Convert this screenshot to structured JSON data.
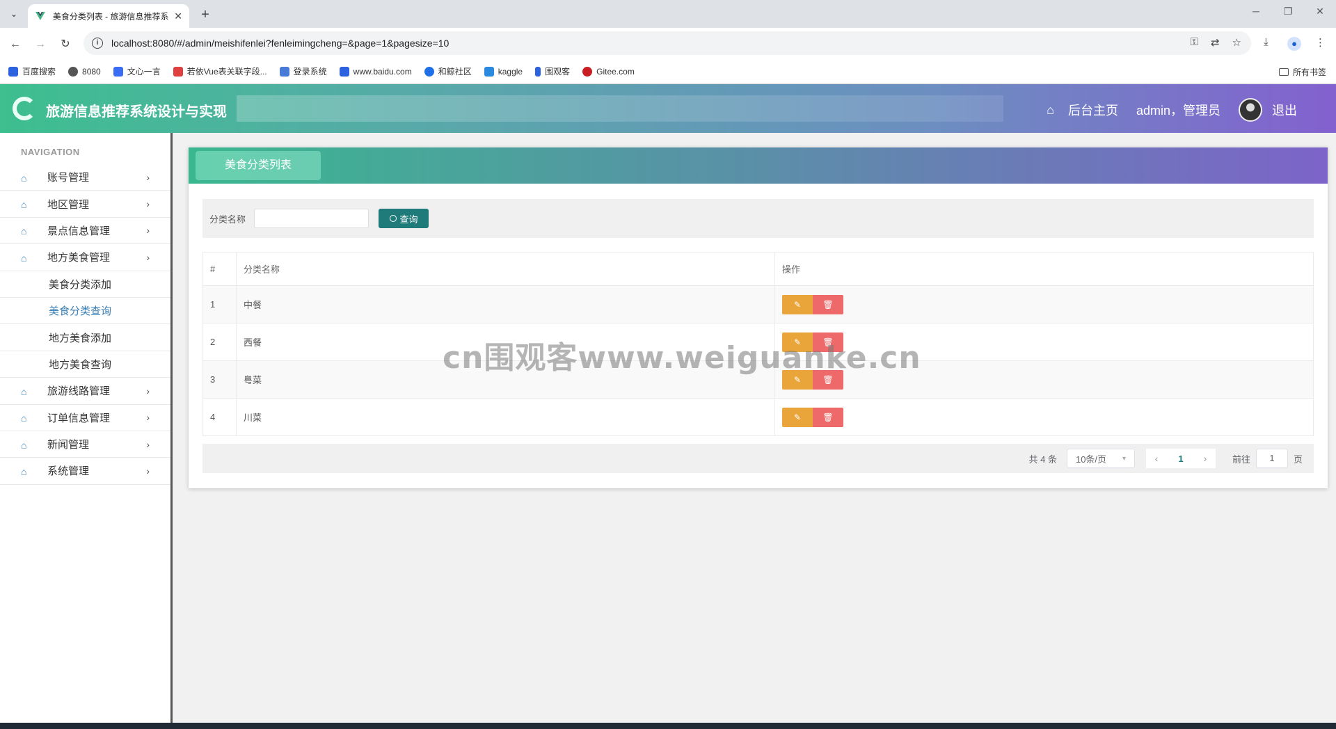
{
  "browser": {
    "tab_title": "美食分类列表 - 旅游信息推荐系统设计与实现",
    "tab_close": "✕",
    "new_tab": "+",
    "url": "localhost:8080/#/admin/meishifenlei?fenleimingcheng=&page=1&pagesize=10",
    "bookmarks": [
      {
        "label": "百度搜索",
        "color": "#2c62e0"
      },
      {
        "label": "8080",
        "color": "#555555"
      },
      {
        "label": "文心一言",
        "color": "#3a6cf4"
      },
      {
        "label": "若依Vue表关联字段...",
        "color": "#e04040"
      },
      {
        "label": "登录系统",
        "color": "#4a7ad8"
      },
      {
        "label": "www.baidu.com",
        "color": "#2c62e0"
      },
      {
        "label": "和鲸社区",
        "color": "#1e6fe8"
      },
      {
        "label": "kaggle",
        "color": "#2a8ae0"
      },
      {
        "label": "围观客",
        "color": "#2c62e0"
      },
      {
        "label": "Gitee.com",
        "color": "#c71d23"
      }
    ],
    "all_bookmarks": "所有书签"
  },
  "header": {
    "title": "旅游信息推荐系统设计与实现",
    "home_link": "后台主页",
    "user": "admin，管理员",
    "logout": "退出"
  },
  "sidebar": {
    "heading": "NAVIGATION",
    "items": [
      {
        "label": "账号管理"
      },
      {
        "label": "地区管理"
      },
      {
        "label": "景点信息管理"
      },
      {
        "label": "地方美食管理"
      }
    ],
    "sub_items": [
      {
        "label": "美食分类添加"
      },
      {
        "label": "美食分类查询"
      },
      {
        "label": "地方美食添加"
      },
      {
        "label": "地方美食查询"
      }
    ],
    "items_after": [
      {
        "label": "旅游线路管理"
      },
      {
        "label": "订单信息管理"
      },
      {
        "label": "新闻管理"
      },
      {
        "label": "系统管理"
      }
    ]
  },
  "main": {
    "card_title": "美食分类列表",
    "search_label": "分类名称",
    "search_value": "",
    "query_button": "查询",
    "table": {
      "headers": [
        "#",
        "分类名称",
        "操作"
      ],
      "rows": [
        {
          "idx": "1",
          "name": "中餐"
        },
        {
          "idx": "2",
          "name": "西餐"
        },
        {
          "idx": "3",
          "name": "粤菜"
        },
        {
          "idx": "4",
          "name": "川菜"
        }
      ]
    },
    "pager": {
      "total": "共 4 条",
      "page_size": "10条/页",
      "current_page": "1",
      "goto_label": "前往",
      "goto_value": "1",
      "page_suffix": "页"
    }
  },
  "watermark": "cn围观客www.weiguanke.cn",
  "colors": {
    "accent": "#1f7a7a",
    "edit": "#e9a43a",
    "delete": "#ee6a6a",
    "header_start": "#3dbf8f",
    "header_end": "#8361cf"
  }
}
